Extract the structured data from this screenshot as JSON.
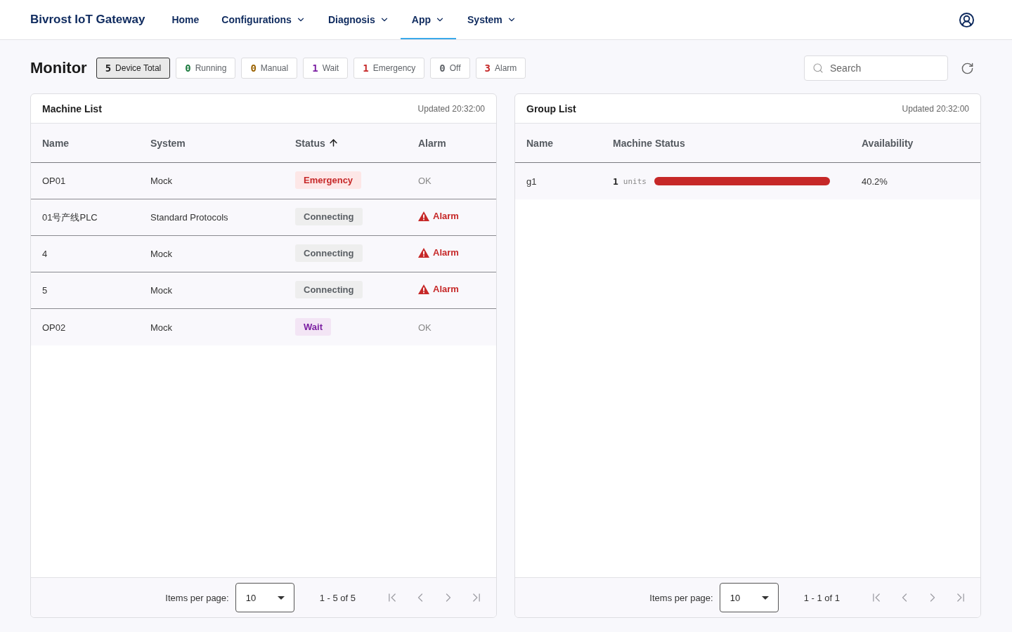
{
  "header": {
    "brand": "Bivrost IoT Gateway",
    "nav": [
      {
        "label": "Home",
        "dropdown": false,
        "selected": false
      },
      {
        "label": "Configurations",
        "dropdown": true,
        "selected": false
      },
      {
        "label": "Diagnosis",
        "dropdown": true,
        "selected": false
      },
      {
        "label": "App",
        "dropdown": true,
        "selected": true
      },
      {
        "label": "System",
        "dropdown": true,
        "selected": false
      }
    ]
  },
  "toolbar": {
    "title": "Monitor",
    "filters": [
      {
        "count": "5",
        "label": "Device Total",
        "kind": "total",
        "selected": true
      },
      {
        "count": "0",
        "label": "Running",
        "kind": "running",
        "selected": false
      },
      {
        "count": "0",
        "label": "Manual",
        "kind": "manual",
        "selected": false
      },
      {
        "count": "1",
        "label": "Wait",
        "kind": "wait",
        "selected": false
      },
      {
        "count": "1",
        "label": "Emergency",
        "kind": "emergency",
        "selected": false
      },
      {
        "count": "0",
        "label": "Off",
        "kind": "off",
        "selected": false
      },
      {
        "count": "3",
        "label": "Alarm",
        "kind": "alarm",
        "selected": false
      }
    ],
    "search": {
      "placeholder": "Search"
    }
  },
  "machine_list": {
    "title": "Machine List",
    "updated": "Updated 20:32:00",
    "columns": [
      {
        "label": "Name",
        "sorted": false
      },
      {
        "label": "System",
        "sorted": false
      },
      {
        "label": "Status",
        "sorted": true
      },
      {
        "label": "Alarm",
        "sorted": false
      }
    ],
    "rows": [
      {
        "name": "OP01",
        "system": "Mock",
        "status": {
          "label": "Emergency",
          "kind": "emergency"
        },
        "alarm": {
          "label": "OK",
          "kind": "ok"
        }
      },
      {
        "name": "01号产线PLC",
        "system": "Standard Protocols",
        "status": {
          "label": "Connecting",
          "kind": "connecting"
        },
        "alarm": {
          "label": "Alarm",
          "kind": "alarm"
        }
      },
      {
        "name": "4",
        "system": "Mock",
        "status": {
          "label": "Connecting",
          "kind": "connecting"
        },
        "alarm": {
          "label": "Alarm",
          "kind": "alarm"
        }
      },
      {
        "name": "5",
        "system": "Mock",
        "status": {
          "label": "Connecting",
          "kind": "connecting"
        },
        "alarm": {
          "label": "Alarm",
          "kind": "alarm"
        }
      },
      {
        "name": "OP02",
        "system": "Mock",
        "status": {
          "label": "Wait",
          "kind": "wait"
        },
        "alarm": {
          "label": "OK",
          "kind": "ok"
        }
      }
    ],
    "pagination": {
      "label": "Items per page:",
      "page_size": "10",
      "range": "1 - 5 of 5",
      "buttons": [
        {
          "kind": "first",
          "disabled": true
        },
        {
          "kind": "previous",
          "disabled": true
        },
        {
          "kind": "next",
          "disabled": true
        },
        {
          "kind": "last",
          "disabled": true
        }
      ]
    }
  },
  "group_list": {
    "title": "Group List",
    "updated": "Updated 20:32:00",
    "columns": [
      {
        "label": "Name",
        "sorted": false
      },
      {
        "label": "Machine Status",
        "sorted": false
      },
      {
        "label": "Availability",
        "sorted": false
      }
    ],
    "rows": [
      {
        "name": "g1",
        "unit_count": "1",
        "unit_label": "units",
        "segments": [
          {
            "kind": "emergency",
            "level": 1
          }
        ],
        "availability": "40.2%"
      }
    ],
    "pagination": {
      "label": "Items per page:",
      "page_size": "10",
      "range": "1 - 1 of 1",
      "buttons": [
        {
          "kind": "first",
          "disabled": true
        },
        {
          "kind": "previous",
          "disabled": true
        },
        {
          "kind": "next",
          "disabled": true
        },
        {
          "kind": "last",
          "disabled": true
        }
      ]
    }
  }
}
